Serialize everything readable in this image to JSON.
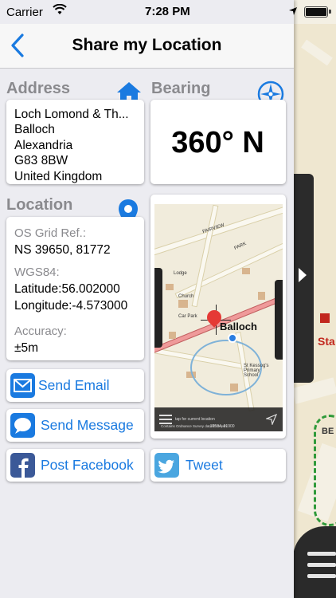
{
  "status_bar": {
    "carrier": "Carrier",
    "time": "7:28 PM"
  },
  "nav": {
    "title": "Share my Location",
    "back_label": "Back"
  },
  "address": {
    "heading": "Address",
    "lines": [
      "Loch Lomond & Th...",
      "Balloch",
      "Alexandria",
      "G83 8BW",
      "United Kingdom"
    ]
  },
  "bearing": {
    "heading": "Bearing",
    "value": "360° N"
  },
  "location": {
    "heading": "Location",
    "os_grid_label": "OS Grid Ref.:",
    "os_grid_value": "NS  39650, 81772",
    "wgs_label": "WGS84:",
    "latitude_label": "Latitude:",
    "latitude_value": "56.002000",
    "longitude_label": "Longitude:",
    "longitude_value": "-4.573000",
    "accuracy_label": "Accuracy:",
    "accuracy_value": "±5m"
  },
  "mini_map": {
    "place_name": "Balloch",
    "tap_note": "tap for current location",
    "copyright": "Contains Ordnance Survey data © Crown",
    "grid_ref": "39594, 81900",
    "labels": [
      "Lodge",
      "Church",
      "Car Park",
      "St Kessog's Primary School",
      "FAIRVIEW",
      "PARK"
    ]
  },
  "actions": {
    "send_email": "Send Email",
    "send_message": "Send Message",
    "post_facebook": "Post Facebook",
    "tweet": "Tweet"
  },
  "background_map": {
    "labels": [
      "Sta",
      "BE"
    ]
  },
  "colors": {
    "accent_blue": "#1a7ae0",
    "facebook_blue": "#3b5998",
    "twitter_blue": "#4aa6e0",
    "section_gray": "#8a8a8e"
  }
}
